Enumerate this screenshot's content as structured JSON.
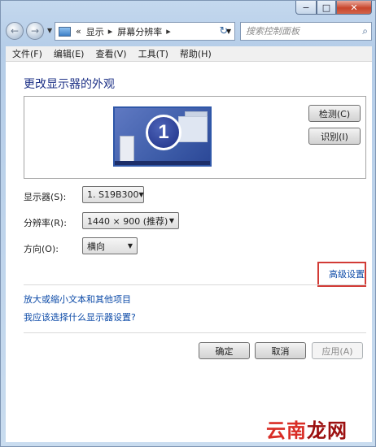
{
  "window": {
    "minimize": "−",
    "maximize": "□",
    "close": "✕"
  },
  "navigation": {
    "back_icon": "←",
    "forward_icon": "→",
    "breadcrumb_prefix": "«",
    "breadcrumb": [
      "显示",
      "屏幕分辨率"
    ],
    "breadcrumb_separator": "▸",
    "refresh_icon": "↻",
    "search_placeholder": "搜索控制面板",
    "search_icon": "⌕"
  },
  "menu": [
    "文件(F)",
    "编辑(E)",
    "查看(V)",
    "工具(T)",
    "帮助(H)"
  ],
  "page": {
    "title": "更改显示器的外观",
    "monitor_number": "1",
    "detect_button": "检测(C)",
    "identify_button": "识别(I)",
    "display_label": "显示器(S):",
    "display_value": "1. S19B300",
    "resolution_label": "分辨率(R):",
    "resolution_value": "1440 × 900 (推荐)",
    "orientation_label": "方向(O):",
    "orientation_value": "横向",
    "advanced_link": "高级设置",
    "link_text_size": "放大或缩小文本和其他项目",
    "link_which_settings": "我应该选择什么显示器设置?",
    "ok_button": "确定",
    "cancel_button": "取消",
    "apply_button": "应用(A)"
  },
  "watermark": {
    "text_part1": "云南",
    "text_part2": "龙网"
  },
  "colors": {
    "title_blue": "#1e3287",
    "link_blue": "#0d4ba8",
    "highlight_red": "#d23b36"
  }
}
